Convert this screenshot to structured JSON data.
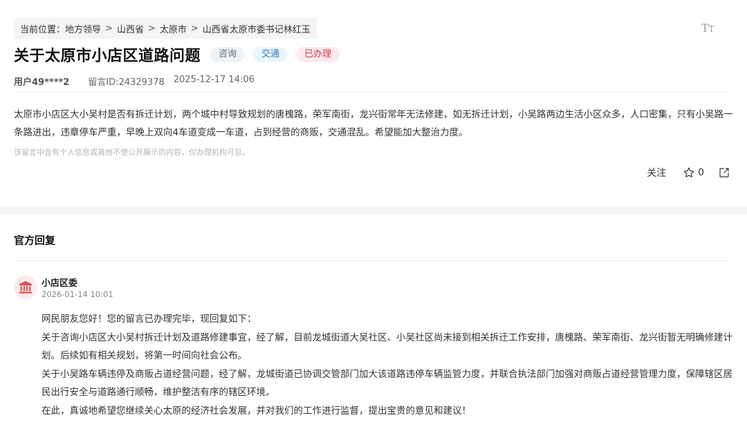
{
  "breadcrumb": {
    "prefix": "当前位置：",
    "items": [
      "地方领导",
      "山西省",
      "太原市",
      "山西省太原市委书记林红玉"
    ],
    "separator": ">"
  },
  "toolbar": {
    "font_size_icon": "text-size-icon",
    "font_size_label": "T",
    "font_size_small": "T"
  },
  "post": {
    "title": "关于太原市小店区道路问题",
    "tags": [
      "咨询",
      "交通",
      "已办理"
    ],
    "user": "用户49****2",
    "message_id": "留言ID:24329378",
    "datetime": "2025-12-17 14:06",
    "content": "太原市小店区大小吴村是否有拆迁计划，两个城中村导致规划的唐槐路，荣军南街，龙兴街常年无法修建，如无拆迁计划，小吴路两边生活小区众多，人口密集，只有小吴路一条路进出，违章停车严重，早晚上双向4车道变成一车道，占到经营的商贩，交通混乱。希望能加大整治力度。",
    "privacy_note": "该留言中含有个人信息或其他不便公开展示的内容，仅办理机构可见。"
  },
  "actions": {
    "follow_label": "关注",
    "like_count": "0"
  },
  "reply": {
    "heading": "官方回复",
    "org_name": "小店区委",
    "datetime": "2026-01-14 10:01",
    "paragraphs": [
      "网民朋友您好！您的留言已办理完毕，现回复如下：",
      "关于咨询小店区大小吴村拆迁计划及道路修建事宜，经了解，目前龙城街道大吴社区、小吴社区尚未接到相关拆迁工作安排，唐槐路、荣军南街、龙兴街暂无明确修建计划。后续如有相关规划，将第一时间向社会公布。",
      "关于小吴路车辆违停及商贩占道经营问题，经了解，龙城街道已协调交管部门加大该道路违停车辆监管力度，并联合执法部门加强对商贩占道经营管理力度，保障辖区居民出行安全与道路通行顺畅，维护整洁有序的辖区环境。",
      "在此，真诚地希望您继续关心太原的经济社会发展，并对我们的工作进行监督，提出宝贵的意见和建议！"
    ]
  },
  "colors": {
    "tag_done": "#d23a4a",
    "tag_traffic": "#2f7ec0",
    "avatar_icon": "#d9534f"
  }
}
